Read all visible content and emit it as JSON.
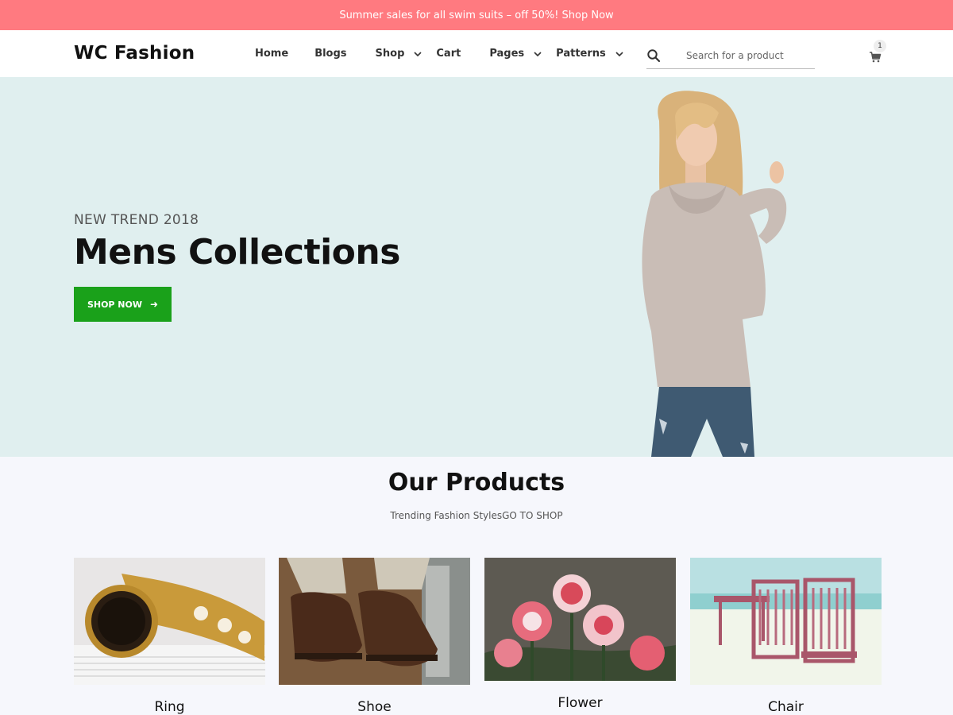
{
  "topbar": {
    "text": "Summer sales for all swim suits – off 50%! Shop Now"
  },
  "header": {
    "logo": "WC Fashion",
    "nav": [
      {
        "label": "Home",
        "has_dropdown": false
      },
      {
        "label": "Blogs",
        "has_dropdown": false
      },
      {
        "label": "Shop",
        "has_dropdown": true
      },
      {
        "label": "Cart",
        "has_dropdown": false
      },
      {
        "label": "Pages",
        "has_dropdown": true
      },
      {
        "label": "Patterns",
        "has_dropdown": true
      }
    ],
    "search": {
      "placeholder": "Search for a product",
      "value": ""
    },
    "cart_count": "1"
  },
  "hero": {
    "subtitle": "NEW TREND 2018",
    "title": "Mens Collections",
    "button_label": "SHOP NOW"
  },
  "products": {
    "title": "Our Products",
    "subtitle": "Trending Fashion StylesGO TO SHOP",
    "items": [
      {
        "name": "Ring"
      },
      {
        "name": "Shoe"
      },
      {
        "name": "Flower"
      },
      {
        "name": "Chair"
      }
    ]
  },
  "colors": {
    "topbar": "#ff7a80",
    "hero_bg": "#e0efef",
    "button": "#1aa11a",
    "page_bg": "#f6f7fc"
  },
  "icons": [
    "search-icon",
    "cart-icon",
    "chevron-down-icon",
    "arrow-right-icon"
  ]
}
